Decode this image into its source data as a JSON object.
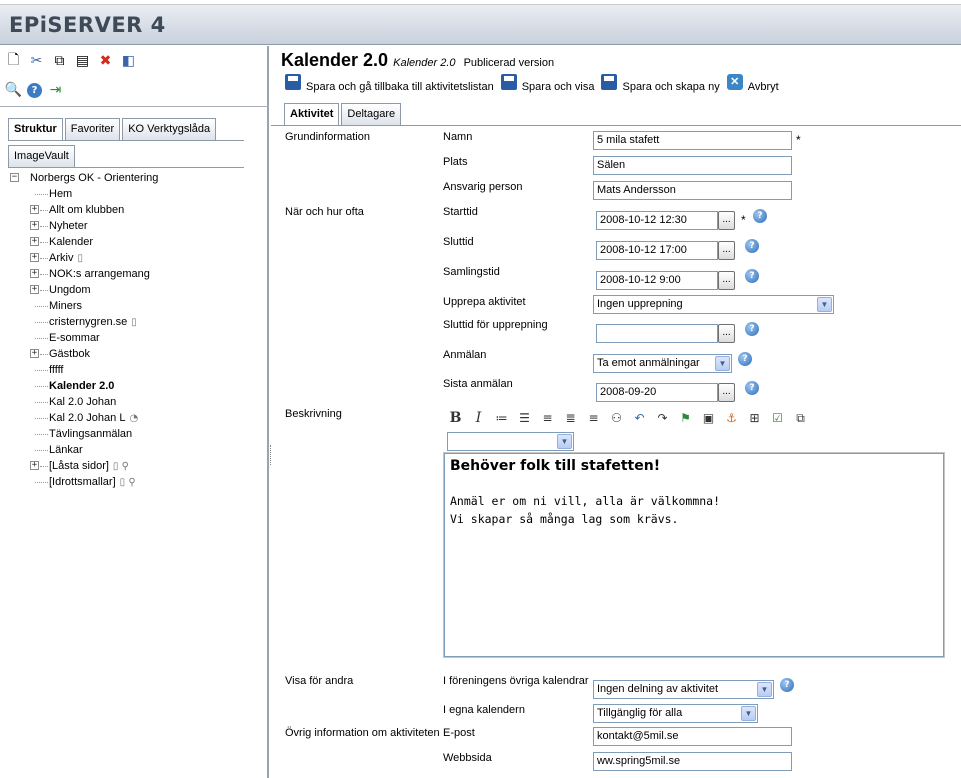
{
  "app": {
    "logo": "EPiSERVER 4"
  },
  "toolbar": {
    "row1": [
      {
        "icon": "new-page-icon",
        "glyph": "🗋"
      },
      {
        "icon": "cut-icon",
        "glyph": "✂"
      },
      {
        "icon": "copy-icon",
        "glyph": "⧉"
      },
      {
        "icon": "paste-icon",
        "glyph": "▤"
      },
      {
        "icon": "delete-icon",
        "glyph": "✖"
      },
      {
        "icon": "panel-icon",
        "glyph": "◧"
      }
    ],
    "row2": [
      {
        "icon": "search-icon",
        "glyph": "🔍"
      },
      {
        "icon": "help-icon",
        "glyph": "?"
      },
      {
        "icon": "logout-icon",
        "glyph": "⇥"
      }
    ]
  },
  "left_tabs": [
    "Struktur",
    "Favoriter",
    "KO Verktygslåda",
    "ImageVault"
  ],
  "tree": {
    "root": "Norbergs OK - Orientering",
    "items": [
      {
        "label": "Hem",
        "expandable": false,
        "icon": ""
      },
      {
        "label": "Allt om klubben",
        "expandable": true,
        "icon": ""
      },
      {
        "label": "Nyheter",
        "expandable": true,
        "icon": ""
      },
      {
        "label": "Kalender",
        "expandable": true,
        "icon": ""
      },
      {
        "label": "Arkiv",
        "expandable": true,
        "icon": "▯"
      },
      {
        "label": "NOK:s arrangemang",
        "expandable": true,
        "icon": ""
      },
      {
        "label": "Ungdom",
        "expandable": true,
        "icon": ""
      },
      {
        "label": "Miners",
        "expandable": false,
        "icon": ""
      },
      {
        "label": "cristernygren.se",
        "expandable": false,
        "icon": "▯"
      },
      {
        "label": "E-sommar",
        "expandable": false,
        "icon": ""
      },
      {
        "label": "Gästbok",
        "expandable": true,
        "icon": ""
      },
      {
        "label": "fffff",
        "expandable": false,
        "icon": ""
      },
      {
        "label": "Kalender 2.0",
        "expandable": false,
        "icon": "",
        "bold": true
      },
      {
        "label": "Kal 2.0 Johan",
        "expandable": false,
        "icon": ""
      },
      {
        "label": "Kal 2.0 Johan L",
        "expandable": false,
        "icon": "◔"
      },
      {
        "label": "Tävlingsanmälan",
        "expandable": false,
        "icon": ""
      },
      {
        "label": "Länkar",
        "expandable": false,
        "icon": ""
      },
      {
        "label": "[Låsta sidor]",
        "expandable": true,
        "icon": "▯ ⚲"
      },
      {
        "label": "[Idrottsmallar]",
        "expandable": false,
        "icon": "▯ ⚲"
      }
    ]
  },
  "page": {
    "title": "Kalender 2.0",
    "type": "Kalender 2.0",
    "status": "Publicerad version"
  },
  "actions": [
    {
      "label": "Spara och gå tillbaka till aktivitetslistan",
      "icon": "save-icon"
    },
    {
      "label": "Spara och visa",
      "icon": "save-icon"
    },
    {
      "label": "Spara och skapa ny",
      "icon": "save-icon"
    },
    {
      "label": "Avbryt",
      "icon": "cancel-icon"
    }
  ],
  "tabs": [
    "Aktivitet",
    "Deltagare"
  ],
  "form": {
    "section_basic": "Grundinformation",
    "name_label": "Namn",
    "name_value": "5 mila stafett",
    "place_label": "Plats",
    "place_value": "Sälen",
    "resp_label": "Ansvarig person",
    "resp_value": "Mats Andersson",
    "section_when": "När och hur ofta",
    "start_label": "Starttid",
    "start_value": "2008-10-12 12:30",
    "end_label": "Sluttid",
    "end_value": "2008-10-12 17:00",
    "gather_label": "Samlingstid",
    "gather_value": "2008-10-12 9:00",
    "repeat_label": "Upprepa aktivitet",
    "repeat_value": "Ingen upprepning",
    "repeat_end_label": "Sluttid för upprepning",
    "repeat_end_value": "",
    "signup_label": "Anmälan",
    "signup_value": "Ta emot anmälningar",
    "last_signup_label": "Sista anmälan",
    "last_signup_value": "2008-09-20",
    "section_desc": "Beskrivning",
    "rte_heading": "Behöver folk till stafetten!",
    "rte_line1": "Anmäl er om ni vill, alla är välkommna!",
    "rte_line2": "Vi skapar så många lag som krävs.",
    "rte_style_value": "",
    "section_share": "Visa för andra",
    "other_cal_label": "I föreningens övriga kalendrar",
    "other_cal_value": "Ingen delning av aktivitet",
    "own_cal_label": "I egna kalendern",
    "own_cal_value": "Tillgänglig för alla",
    "section_other": "Övrig information om aktiviteten",
    "email_label": "E-post",
    "email_value": "kontakt@5mil.se",
    "web_label": "Webbsida",
    "web_value": "ww.spring5mil.se",
    "required_mark": "*",
    "dots": "...",
    "help_mark": "?"
  },
  "rte_toolbar": [
    {
      "icon": "bold-icon",
      "glyph": "B"
    },
    {
      "icon": "italic-icon",
      "glyph": "I"
    },
    {
      "icon": "ordered-list-icon",
      "glyph": "≔"
    },
    {
      "icon": "unordered-list-icon",
      "glyph": "☰"
    },
    {
      "icon": "align-left-icon",
      "glyph": "≡"
    },
    {
      "icon": "align-center-icon",
      "glyph": "≣"
    },
    {
      "icon": "align-right-icon",
      "glyph": "≡"
    },
    {
      "icon": "find-icon",
      "glyph": "⚇"
    },
    {
      "icon": "undo-icon",
      "glyph": "↶"
    },
    {
      "icon": "redo-icon",
      "glyph": "↷"
    },
    {
      "icon": "insert-link-icon",
      "glyph": "⚑"
    },
    {
      "icon": "insert-image-icon",
      "glyph": "▣"
    },
    {
      "icon": "insert-anchor-icon",
      "glyph": "⚓"
    },
    {
      "icon": "insert-table-icon",
      "glyph": "⊞"
    },
    {
      "icon": "spellcheck-icon",
      "glyph": "☑"
    },
    {
      "icon": "paste-text-icon",
      "glyph": "⧉"
    }
  ]
}
